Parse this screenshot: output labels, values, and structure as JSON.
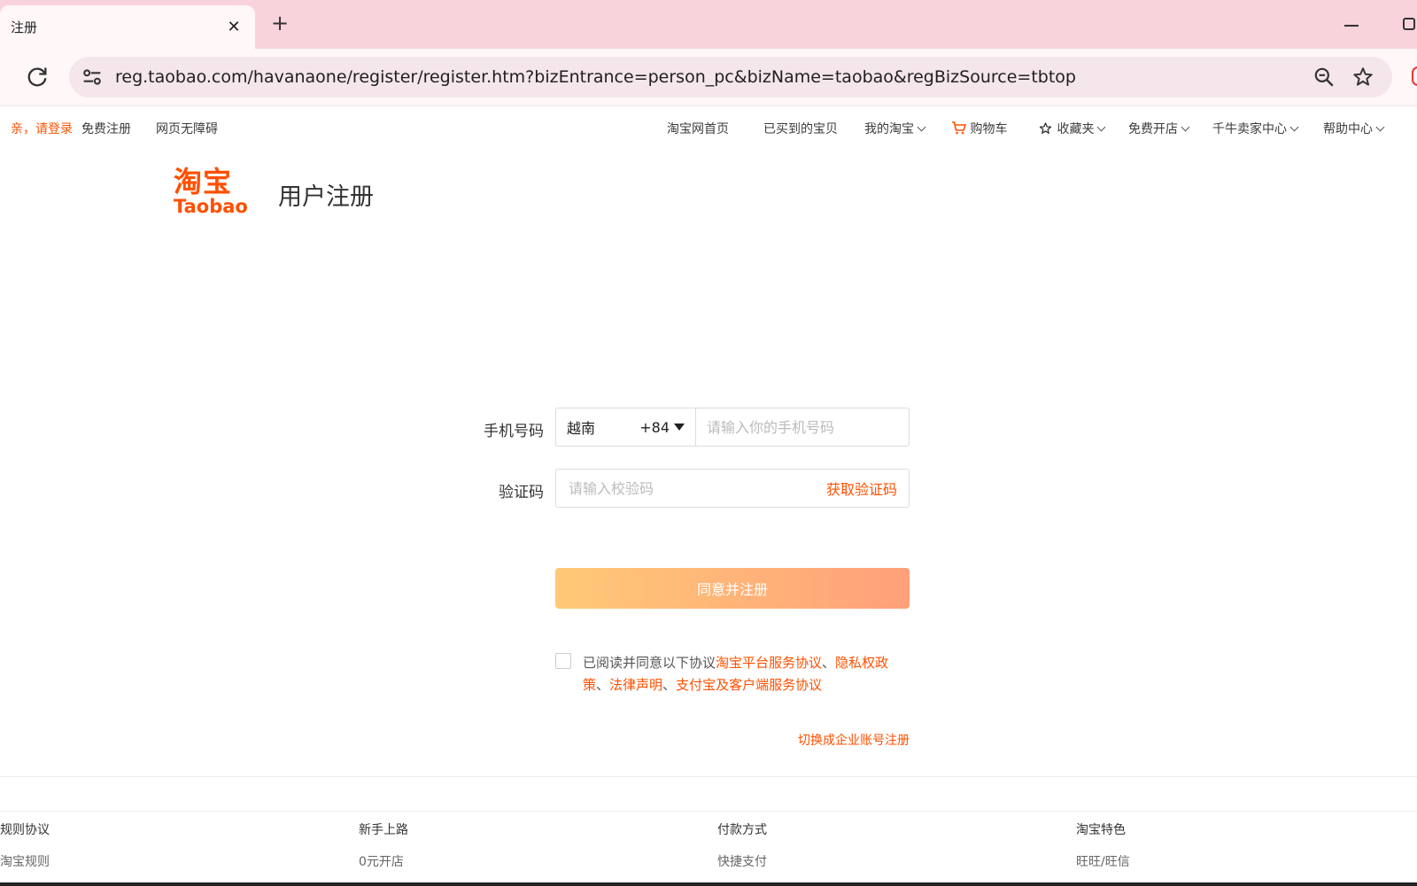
{
  "browser": {
    "tab_title": "注册",
    "close_symbol": "✕",
    "new_tab_symbol": "+",
    "url": "reg.taobao.com/havanaone/register/register.htm?bizEntrance=person_pc&bizName=taobao&regBizSource=tbtop"
  },
  "sitenav": {
    "greeting": "亲，请登录",
    "free_register": "免费注册",
    "accessibility": "网页无障碍",
    "home": "淘宝网首页",
    "purchased": "已买到的宝贝",
    "my_taobao": "我的淘宝",
    "cart": "购物车",
    "favorites": "收藏夹",
    "open_shop": "免费开店",
    "seller_center": "千牛卖家中心",
    "help": "帮助中心"
  },
  "logo": {
    "cn": "淘宝",
    "en": "Taobao"
  },
  "page_title": "用户注册",
  "form": {
    "phone_label": "手机号码",
    "country_name": "越南",
    "country_code": "+84",
    "phone_placeholder": "请输入你的手机号码",
    "code_label": "验证码",
    "code_placeholder": "请输入校验码",
    "get_code": "获取验证码",
    "submit": "同意并注册",
    "agree_prefix": "已阅读并同意以下协议",
    "agree_links": [
      "淘宝平台服务协议",
      "隐私权政策",
      "法律声明",
      "支付宝及客户端服务协议"
    ],
    "sep": "、",
    "switch_enterprise": "切换成企业账号注册"
  },
  "footer": {
    "columns": [
      {
        "heading": "规则协议",
        "link": "淘宝规则"
      },
      {
        "heading": "新手上路",
        "link": "0元开店"
      },
      {
        "heading": "付款方式",
        "link": "快捷支付"
      },
      {
        "heading": "淘宝特色",
        "link": "旺旺/旺信"
      }
    ]
  },
  "colors": {
    "brand": "#ff5000",
    "tabbar": "#f8d3dc",
    "button_start": "#ffc977",
    "button_end": "#ffa07a"
  }
}
